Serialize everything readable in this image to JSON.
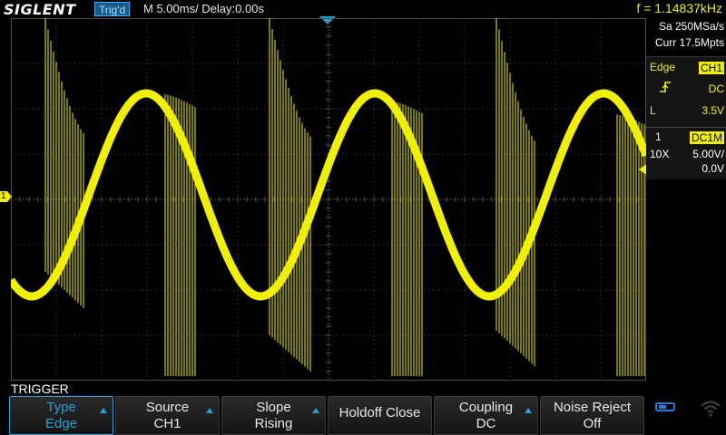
{
  "header": {
    "brand": "SIGLENT",
    "trigger_state": "Trig'd",
    "timebase": "M 5.00ms/ Delay:0.00s",
    "frequency": "f = 1.14837kHz"
  },
  "right_panel": {
    "sample_rate": "Sa 250MSa/s",
    "memory": "Curr 17.5Mpts",
    "trigger": {
      "type": "Edge",
      "source": "CH1",
      "slope_icon": "rising-edge-icon",
      "coupling": "DC",
      "level_label": "L",
      "level": "3.5V"
    },
    "channel": {
      "number": "1",
      "coupling": "DC1M",
      "probe": "10X",
      "scale": "5.00V/",
      "offset": "0.0V"
    }
  },
  "markers": {
    "channel_marker": "1"
  },
  "menu": {
    "title": "TRIGGER",
    "buttons": [
      {
        "line1": "Type",
        "line2": "Edge"
      },
      {
        "line1": "Source",
        "line2": "CH1"
      },
      {
        "line1": "Slope",
        "line2": "Rising"
      },
      {
        "line1": "Holdoff Close",
        "line2": ""
      },
      {
        "line1": "Coupling",
        "line2": "DC"
      },
      {
        "line1": "Noise Reject",
        "line2": "Off"
      }
    ]
  },
  "colors": {
    "trace": "#f0f000",
    "accent": "#2aa0d8",
    "grid": "#505050"
  }
}
